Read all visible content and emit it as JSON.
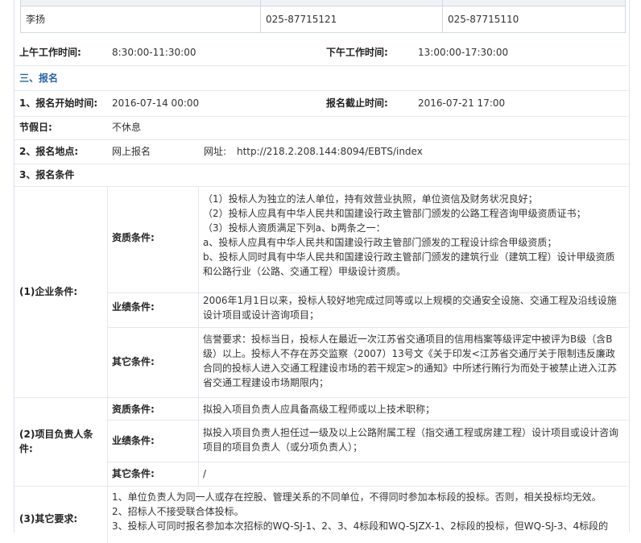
{
  "contact": {
    "name": "李扬",
    "phone1": "025-87715121",
    "phone2": "025-87715110"
  },
  "hours": {
    "am_label": "上午工作时间:",
    "am_value": "8:30:00-11:30:00",
    "pm_label": "下午工作时间:",
    "pm_value": "13:00:00-17:30:00"
  },
  "section3": {
    "title": "三、报名"
  },
  "registration": {
    "start_label": "1、报名开始时间:",
    "start_value": "2016-07-14 00:00",
    "end_label": "报名截止时间:",
    "end_value": "2016-07-21 17:00",
    "holiday_label": "节假日:",
    "holiday_value": "不休息",
    "place_label": "2、报名地点:",
    "place_value": "网上报名",
    "url_label": "网址:",
    "url_value": "http://218.2.208.144:8094/EBTS/index",
    "cond_label": "3、报名条件"
  },
  "enterprise": {
    "label": "(1)企业条件:",
    "qual_label": "资质条件:",
    "qual_lines": [
      "（1）投标人为独立的法人单位，持有效营业执照，单位资信及财务状况良好；",
      "（2）投标人应具有中华人民共和国建设行政主管部门颁发的公路工程咨询甲级资质证书；",
      "（3）投标人资质满足下列a、b两条之一：",
      "a、投标人应具有中华人民共和国建设行政主管部门颁发的工程设计综合甲级资质；",
      "b、投标人同时具有中华人民共和国建设行政主管部门颁发的建筑行业（建筑工程）设计甲级资质",
      "和公路行业（公路、交通工程）甲级设计资质。"
    ],
    "perf_label": "业绩条件:",
    "perf_lines": [
      "2006年1月1日以来，投标人较好地完成过同等或以上规模的交通安全设施、交通工程及沿线设施",
      "设计项目或设计咨询项目；"
    ],
    "other_label": "其它条件:",
    "other_lines": [
      "信誉要求：投标当日，投标人在最近一次江苏省交通项目的信用档案等级评定中被评为B级（含B",
      "级）以上。投标人不存在苏交监察（2007）13号文《关于印发<江苏省交通厅关于限制违反廉政",
      "合同的投标人进入交通工程建设市场的若干规定>的通知》中所述行贿行为而处于被禁止进入江苏",
      "省交通工程建设市场期限内；"
    ]
  },
  "pm": {
    "label_line1": "(2)项目负责人条",
    "label_line2": "件:",
    "qual_label": "资质条件:",
    "qual_value": "拟投入项目负责人应具备高级工程师或以上技术职称；",
    "perf_label": "业绩条件:",
    "perf_lines": [
      "拟投入项目负责人担任过一级及以上公路附属工程（指交通工程或房建工程）设计项目或设计咨询",
      "项目的项目负责人（或分项负责人）；"
    ],
    "other_label": "其它条件:",
    "other_value": "/"
  },
  "other_req": {
    "label": "(3)其它要求:",
    "lines": [
      "1、单位负责人为同一人或存在控股、管理关系的不同单位，不得同时参加本标段的投标。否则，相关投标均无效。",
      "2、招标人不接受联合体投标。",
      "3、投标人可同时报名参加本次招标的WQ-SJ-1、2、3、4标段和WQ-SJZX-1、2标段的投标，但WQ-SJ-3、4标段的"
    ]
  },
  "colors": {
    "section": "#2a64a8",
    "border": "#e3e8ee"
  }
}
